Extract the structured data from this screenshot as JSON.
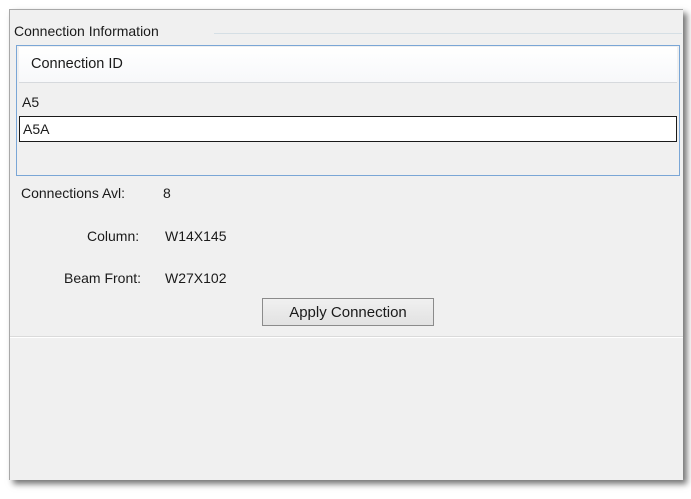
{
  "connection_info": {
    "group_title": "Connection Information",
    "list": {
      "column_header": "Connection ID",
      "rows": [
        "A5",
        "A5A"
      ]
    },
    "fields": {
      "connections_avl_label": "Connections Avl:",
      "connections_avl_value": "8",
      "column_label": "Column:",
      "column_value": "W14X145",
      "beam_front_label": "Beam Front:",
      "beam_front_value": "W27X102"
    },
    "apply_button_label": "Apply Connection"
  }
}
